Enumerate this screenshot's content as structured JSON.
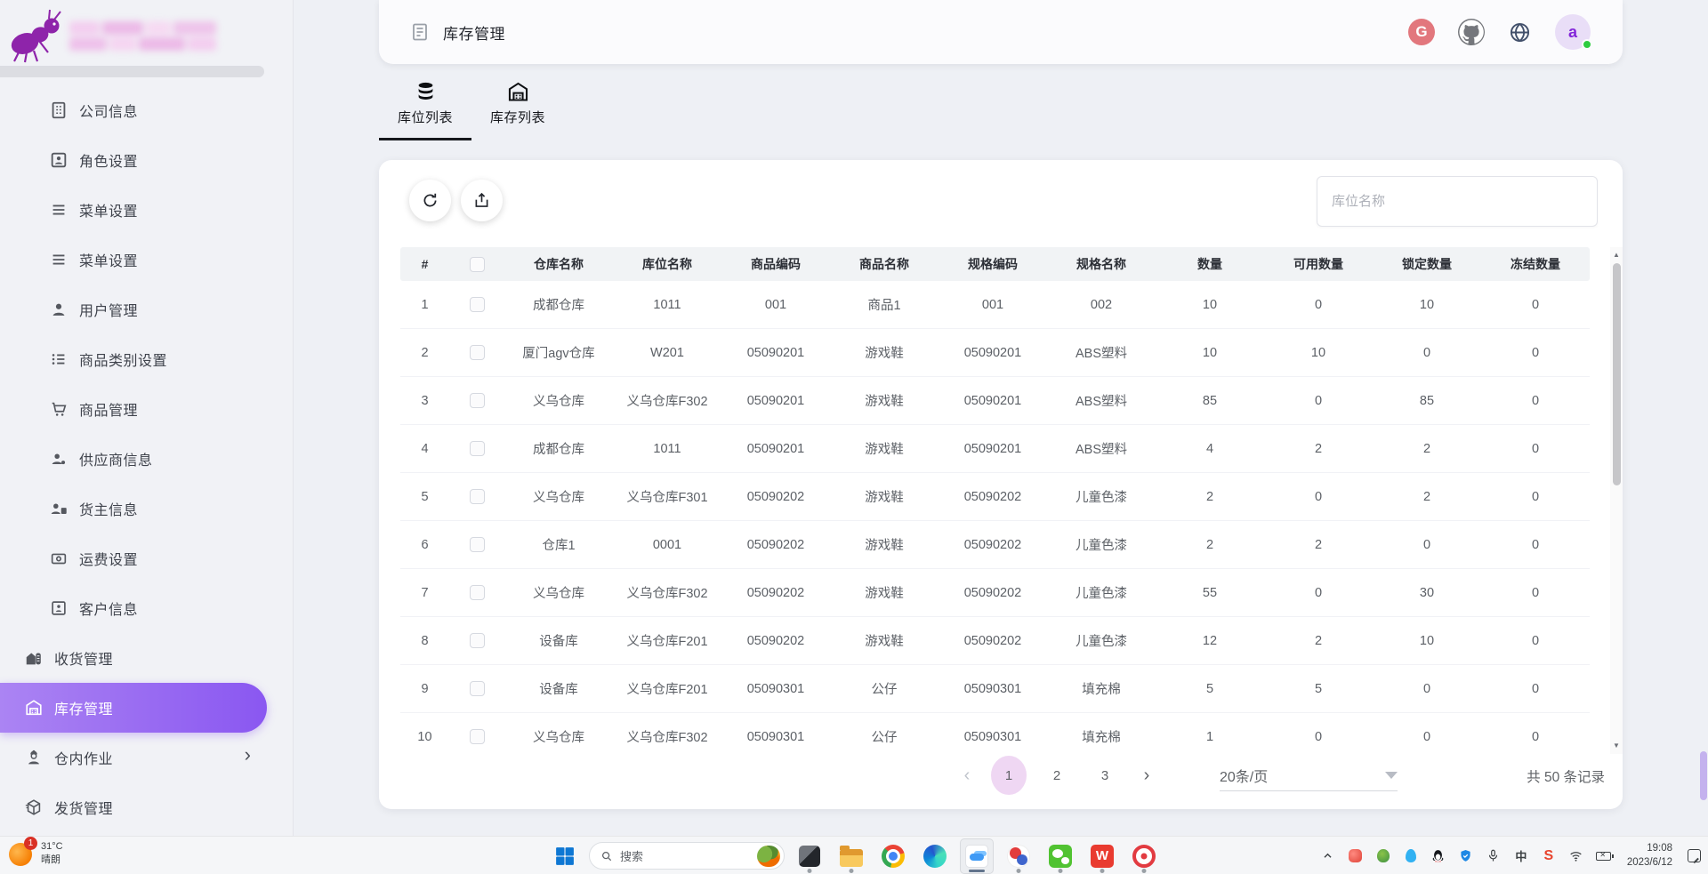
{
  "header": {
    "title": "库存管理",
    "gitee_letter": "G",
    "avatar_letter": "a"
  },
  "sidebar": {
    "items": [
      {
        "id": "company-info",
        "label": "公司信息",
        "icon": "building-icon",
        "sub": true
      },
      {
        "id": "role-settings",
        "label": "角色设置",
        "icon": "role-card-icon",
        "sub": true
      },
      {
        "id": "menu-settings-1",
        "label": "菜单设置",
        "icon": "menu-lines-icon",
        "sub": true
      },
      {
        "id": "menu-settings-2",
        "label": "菜单设置",
        "icon": "menu-lines-icon",
        "sub": true
      },
      {
        "id": "user-management",
        "label": "用户管理",
        "icon": "user-icon",
        "sub": true
      },
      {
        "id": "product-category",
        "label": "商品类别设置",
        "icon": "category-list-icon",
        "sub": true
      },
      {
        "id": "product-management",
        "label": "商品管理",
        "icon": "cart-icon",
        "sub": true
      },
      {
        "id": "supplier-info",
        "label": "供应商信息",
        "icon": "supplier-icon",
        "sub": true
      },
      {
        "id": "owner-info",
        "label": "货主信息",
        "icon": "owner-icon",
        "sub": true
      },
      {
        "id": "freight-settings",
        "label": "运费设置",
        "icon": "freight-icon",
        "sub": true
      },
      {
        "id": "customer-info",
        "label": "客户信息",
        "icon": "customer-card-icon",
        "sub": true
      },
      {
        "id": "receiving-management",
        "label": "收货管理",
        "icon": "receiving-icon",
        "sub": false
      },
      {
        "id": "inventory-management",
        "label": "库存管理",
        "icon": "warehouse-icon",
        "sub": false,
        "active": true
      },
      {
        "id": "warehouse-operations",
        "label": "仓内作业",
        "icon": "worker-icon",
        "sub": false,
        "chevron": true
      },
      {
        "id": "shipping-management",
        "label": "发货管理",
        "icon": "shipping-icon",
        "sub": false
      }
    ]
  },
  "tabs": [
    {
      "label": "库位列表",
      "icon": "database-icon",
      "active": true
    },
    {
      "label": "库存列表",
      "icon": "warehouse-icon",
      "active": false
    }
  ],
  "toolbar": {
    "search_placeholder": "库位名称"
  },
  "table": {
    "columns": [
      "#",
      "仓库名称",
      "库位名称",
      "商品编码",
      "商品名称",
      "规格编码",
      "规格名称",
      "数量",
      "可用数量",
      "锁定数量",
      "冻结数量"
    ],
    "rows": [
      [
        "1",
        "成都仓库",
        "1011",
        "001",
        "商品1",
        "001",
        "002",
        "10",
        "0",
        "10",
        "0"
      ],
      [
        "2",
        "厦门agv仓库",
        "W201",
        "05090201",
        "游戏鞋",
        "05090201",
        "ABS塑料",
        "10",
        "10",
        "0",
        "0"
      ],
      [
        "3",
        "义乌仓库",
        "义乌仓库F302",
        "05090201",
        "游戏鞋",
        "05090201",
        "ABS塑料",
        "85",
        "0",
        "85",
        "0"
      ],
      [
        "4",
        "成都仓库",
        "1011",
        "05090201",
        "游戏鞋",
        "05090201",
        "ABS塑料",
        "4",
        "2",
        "2",
        "0"
      ],
      [
        "5",
        "义乌仓库",
        "义乌仓库F301",
        "05090202",
        "游戏鞋",
        "05090202",
        "儿童色漆",
        "2",
        "0",
        "2",
        "0"
      ],
      [
        "6",
        "仓库1",
        "0001",
        "05090202",
        "游戏鞋",
        "05090202",
        "儿童色漆",
        "2",
        "2",
        "0",
        "0"
      ],
      [
        "7",
        "义乌仓库",
        "义乌仓库F302",
        "05090202",
        "游戏鞋",
        "05090202",
        "儿童色漆",
        "55",
        "0",
        "30",
        "0"
      ],
      [
        "8",
        "设备库",
        "义乌仓库F201",
        "05090202",
        "游戏鞋",
        "05090202",
        "儿童色漆",
        "12",
        "2",
        "10",
        "0"
      ],
      [
        "9",
        "设备库",
        "义乌仓库F201",
        "05090301",
        "公仔",
        "05090301",
        "填充棉",
        "5",
        "5",
        "0",
        "0"
      ],
      [
        "10",
        "义乌仓库",
        "义乌仓库F302",
        "05090301",
        "公仔",
        "05090301",
        "填充棉",
        "1",
        "0",
        "0",
        "0"
      ]
    ]
  },
  "pagination": {
    "prev": "‹",
    "next": "›",
    "pages": [
      "1",
      "2",
      "3"
    ],
    "active_page": "1",
    "page_size": "20条/页",
    "total": "共 50 条记录"
  },
  "taskbar": {
    "weather": {
      "temp": "31°C",
      "condition": "晴朗",
      "badge": "1"
    },
    "search_label": "搜索",
    "apps": [
      {
        "name": "app-dark",
        "running": true
      },
      {
        "name": "file-explorer",
        "running": true
      },
      {
        "name": "chrome",
        "running": false
      },
      {
        "name": "edge",
        "running": false
      },
      {
        "name": "cloud-docs",
        "running": true,
        "active": true
      },
      {
        "name": "red-blue-app",
        "running": true
      },
      {
        "name": "wechat",
        "running": true
      },
      {
        "name": "wps",
        "running": true
      },
      {
        "name": "screen-recorder",
        "running": true
      }
    ],
    "tray": [
      "chevron-up",
      "red-app",
      "green-app",
      "drop-app",
      "qq",
      "shield",
      "mic",
      "ime",
      "s-app",
      "wifi",
      "battery"
    ],
    "ime_char": "中",
    "s_char": "S",
    "clock": {
      "time": "19:08",
      "date": "2023/6/12"
    }
  }
}
